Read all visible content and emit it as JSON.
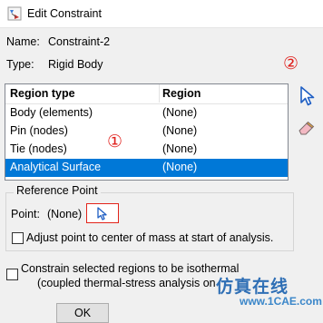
{
  "window": {
    "title": "Edit Constraint"
  },
  "info": {
    "name_label": "Name:",
    "name_value": "Constraint-2",
    "type_label": "Type:",
    "type_value": "Rigid Body"
  },
  "region_table": {
    "headers": [
      "Region type",
      "Region"
    ],
    "rows": [
      {
        "type": "Body (elements)",
        "region": "(None)"
      },
      {
        "type": "Pin (nodes)",
        "region": "(None)"
      },
      {
        "type": "Tie (nodes)",
        "region": "(None)"
      },
      {
        "type": "Analytical Surface",
        "region": "(None)"
      }
    ],
    "selected_row": 3
  },
  "annotations": {
    "marker_1": "①",
    "marker_2": "②"
  },
  "reference_point": {
    "group_title": "Reference Point",
    "point_label": "Point:",
    "point_value": "(None)",
    "adjust_label": "Adjust point to center of mass at start of analysis.",
    "adjust_checked": false
  },
  "isothermal": {
    "label_line1": "Constrain selected regions to be isothermal",
    "label_line2": "(coupled thermal-stress analysis on",
    "checked": false
  },
  "watermark": {
    "text_cn": "仿真在线",
    "url": "www.1CAE.com"
  },
  "buttons": {
    "ok": "OK"
  },
  "icons": [
    "constraint-icon",
    "arrow-pointer-icon",
    "eraser-icon"
  ],
  "colors": {
    "selection": "#0078d7",
    "annotation": "#e0201c",
    "watermark": "#2f6fb5"
  }
}
